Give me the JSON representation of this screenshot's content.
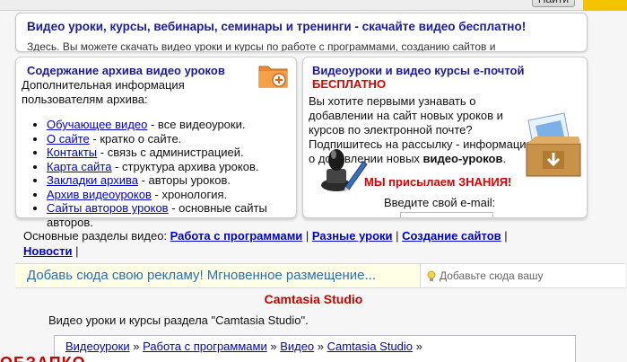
{
  "top": {
    "search_button": "Найти"
  },
  "banner": {
    "title": "Видео уроки, курсы, вебинары, семинары и тренинги - скачайте видео бесплатно!",
    "text": "Здесь. Вы можете скачать видео уроки и курсы по работе с программами, созданию сайтов и"
  },
  "archive_panel": {
    "title": "Содержание архива видео уроков",
    "intro": "Дополнительная информация пользователям архива:",
    "items": [
      {
        "link": "Обучающее видео",
        "desc": " - все видеоуроки."
      },
      {
        "link": "О сайте",
        "desc": " - кратко о сайте."
      },
      {
        "link": "Контакты",
        "desc": " - связь с администрацией."
      },
      {
        "link": "Карта сайта",
        "desc": " - структура архива уроков."
      },
      {
        "link": "Закладки архива",
        "desc": " - авторы уроков."
      },
      {
        "link": "Архив видеоуроков",
        "desc": " - хронология."
      },
      {
        "link": "Сайты авторов уроков",
        "desc": " - основные сайты авторов."
      }
    ],
    "icon": "folder-add-icon"
  },
  "email_panel": {
    "title": "Видеоуроки и видео курсы е-почтой",
    "free": "БЕСПЛАТНО",
    "text_before": "Вы хотите первыми узнавать о добавлении на сайт новых уроков и курсов по электронной почте? Подпишитесь на рассылку - информация о добавлении новых ",
    "text_bold": "видео-уроков",
    "text_after": ".",
    "knowledge": "МЫ присылаем ЗНАНИЯ!",
    "email_label": "Введите свой e-mail:",
    "email_value": "",
    "icons": [
      "stamp-icon",
      "mail-box-icon"
    ]
  },
  "sections": {
    "label": "Основные разделы видео: ",
    "links": [
      "Работа с программами",
      "Разные уроки",
      "Создание сайтов",
      "Новости"
    ]
  },
  "ad": {
    "left_text": "Добавь сюда свою рекламу! Мгновенное размещение...",
    "right_text": "Добавьте сюда вашу"
  },
  "section": {
    "title": "Camtasia Studio",
    "desc": "Видео уроки и курсы раздела \"Camtasia Studio\"."
  },
  "breadcrumb": [
    "Видеоуроки",
    "Работа с программами",
    "Видео",
    "Camtasia Studio"
  ],
  "bottom_partial": "ОБЗАПКО",
  "colors": {
    "link": "#0000cc",
    "accent_red": "#dd0000",
    "title_blue": "#1a1a9a",
    "ad_blue": "#2a6fb0"
  }
}
